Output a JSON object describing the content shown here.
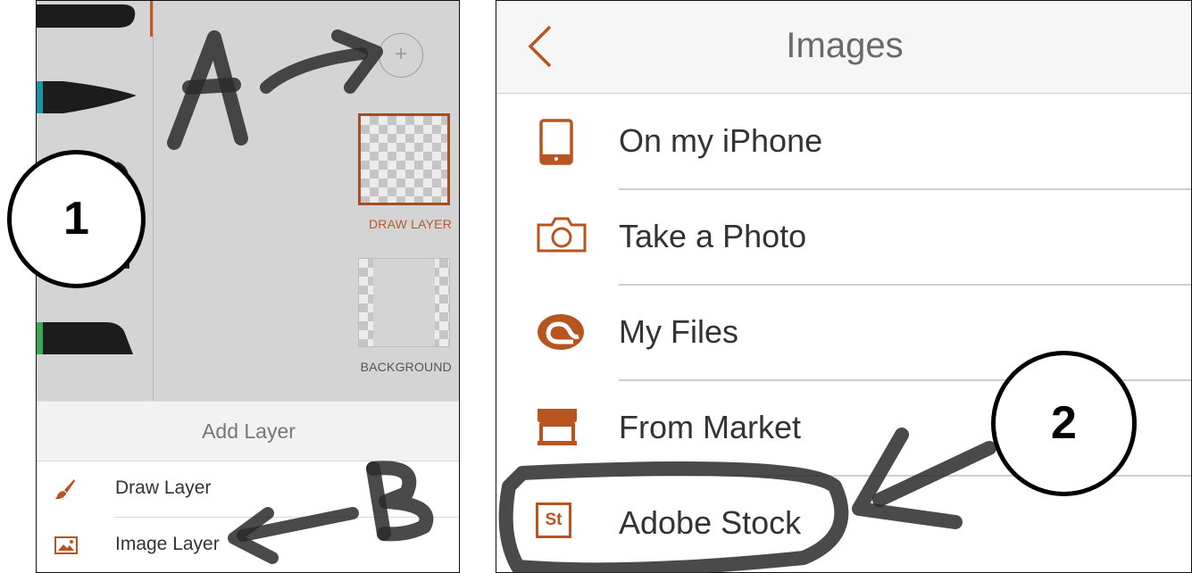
{
  "left_panel": {
    "add_button_label": "+",
    "layers": [
      {
        "label": "DRAW LAYER",
        "selected": true
      },
      {
        "label": "BACKGROUND",
        "selected": false
      }
    ],
    "sheet_title": "Add Layer",
    "sheet_items": [
      {
        "label": "Draw Layer",
        "icon": "brush-icon"
      },
      {
        "label": "Image Layer",
        "icon": "image-icon"
      }
    ],
    "annotations": {
      "callout_number": "1",
      "handwritten_a": "A",
      "handwritten_b": "B"
    }
  },
  "right_panel": {
    "title": "Images",
    "back_icon": "chevron-left-icon",
    "rows": [
      {
        "label": "On my iPhone",
        "icon": "tablet-icon"
      },
      {
        "label": "Take a Photo",
        "icon": "camera-icon"
      },
      {
        "label": "My Files",
        "icon": "creative-cloud-icon"
      },
      {
        "label": "From Market",
        "icon": "market-icon"
      },
      {
        "label": "Adobe Stock",
        "icon": "adobe-stock-icon",
        "icon_text": "St"
      }
    ],
    "annotations": {
      "callout_number": "2"
    }
  },
  "colors": {
    "accent": "#b8541f",
    "text": "#333333",
    "separator": "#cfcfcf"
  }
}
